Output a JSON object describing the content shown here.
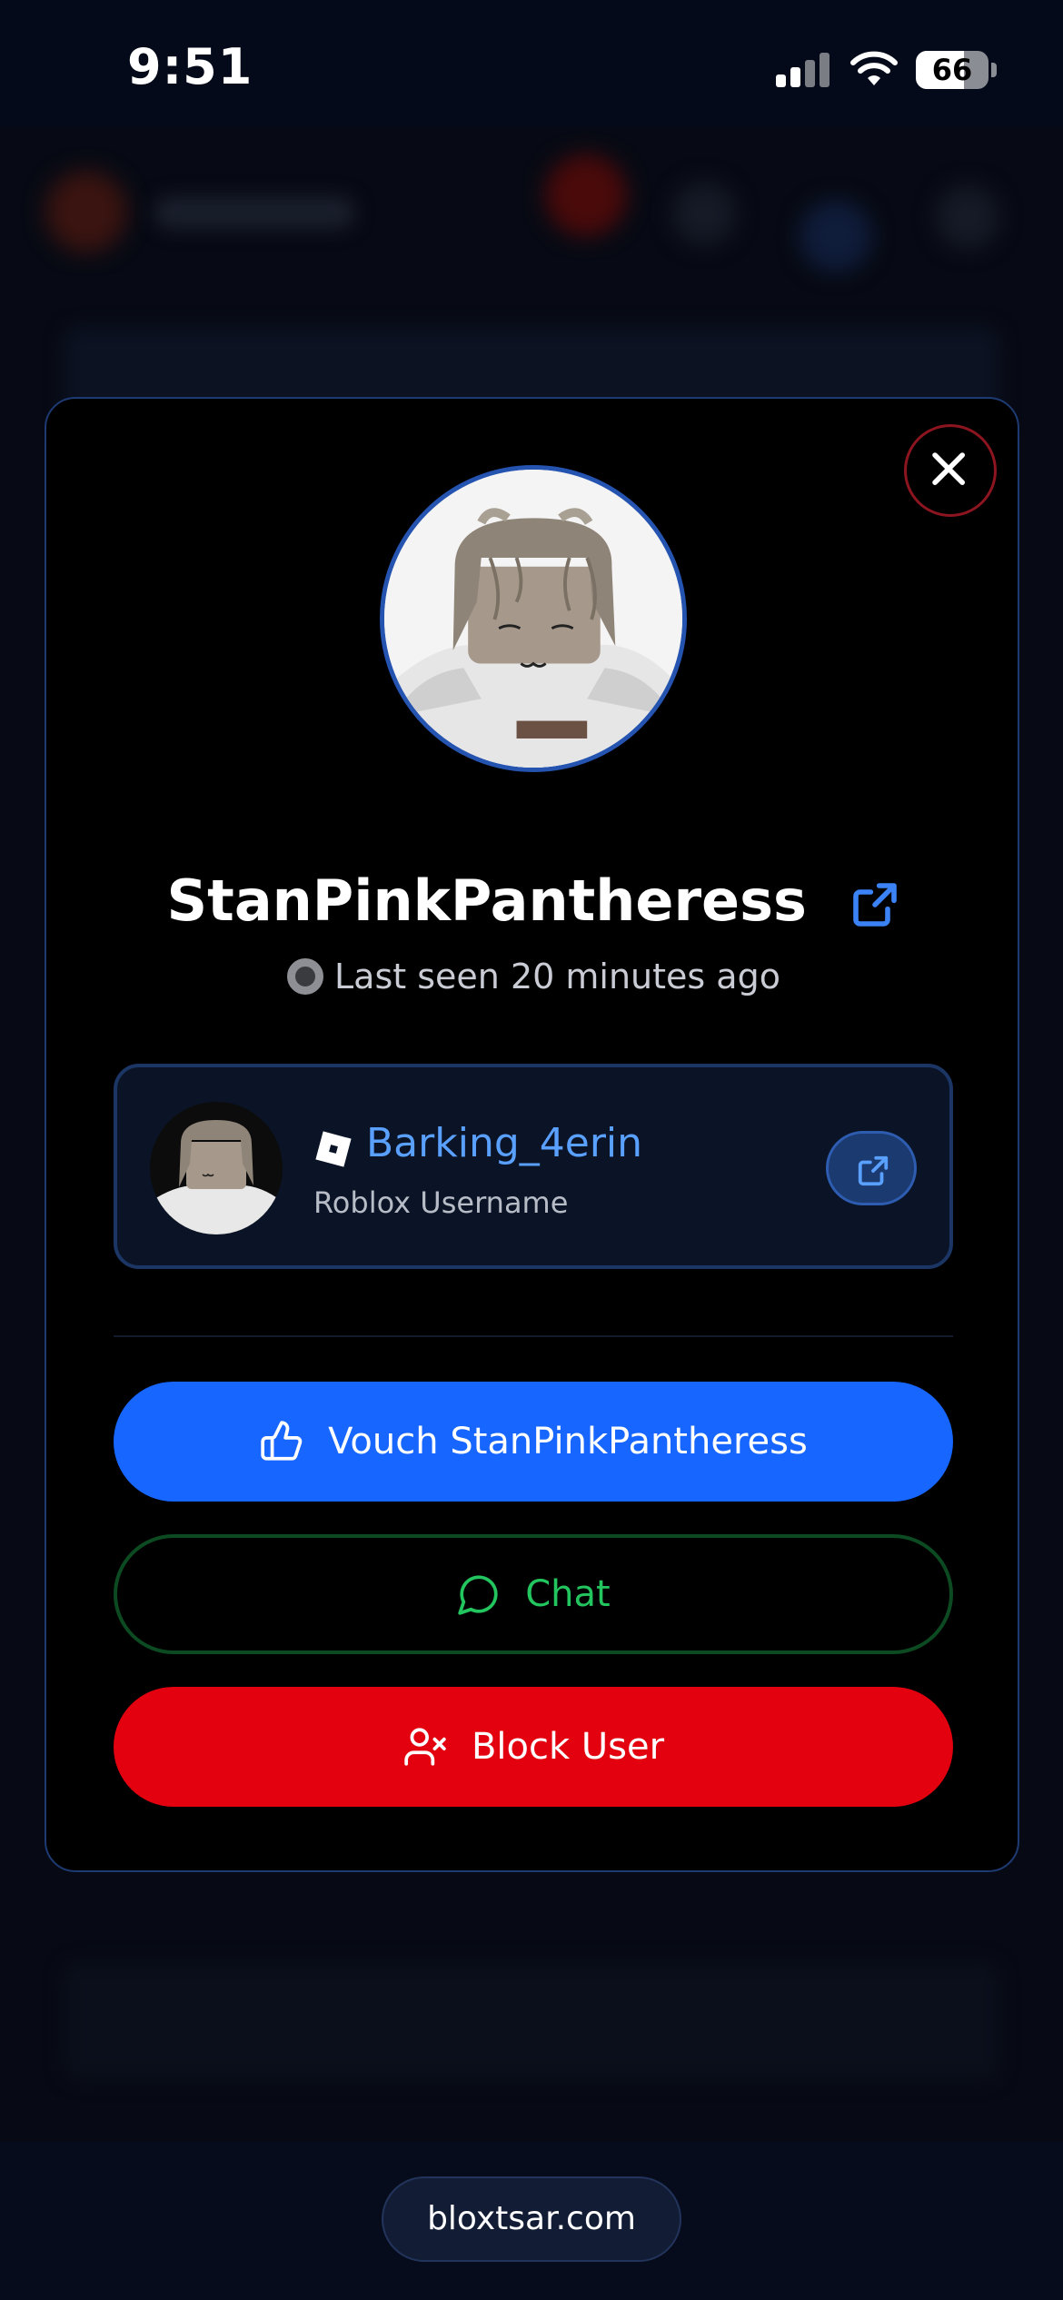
{
  "status_bar": {
    "time": "9:51",
    "battery_level": "66"
  },
  "profile": {
    "display_name": "StanPinkPantheress",
    "last_seen": "Last seen 20 minutes ago"
  },
  "roblox": {
    "username": "Barking_4erin",
    "label": "Roblox Username"
  },
  "actions": {
    "vouch_label": "Vouch StanPinkPantheress",
    "chat_label": "Chat",
    "block_label": "Block User"
  },
  "browser": {
    "url": "bloxtsar.com"
  },
  "colors": {
    "accent_blue": "#1766ff",
    "link_blue": "#5aa0ff",
    "chat_green": "#22c55e",
    "danger_red": "#e3000f",
    "modal_border": "#1d3a72"
  }
}
